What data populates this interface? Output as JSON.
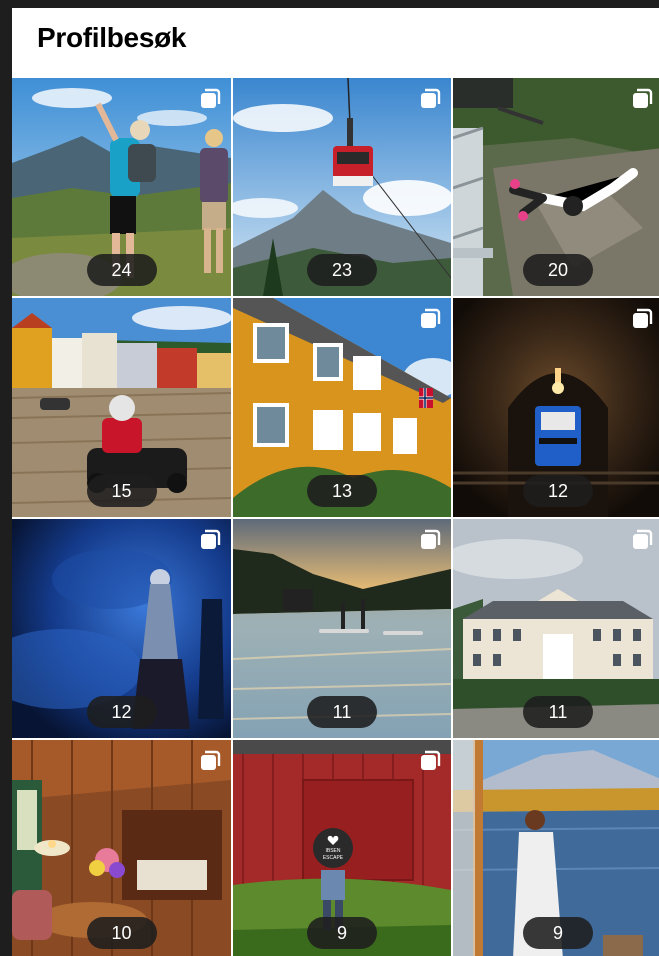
{
  "header": {
    "title": "Profilbesøk"
  },
  "tiles": [
    {
      "count": "24",
      "icon": "multi-image-icon"
    },
    {
      "count": "23",
      "icon": "multi-image-icon"
    },
    {
      "count": "20",
      "icon": "multi-image-icon"
    },
    {
      "count": "15",
      "icon": ""
    },
    {
      "count": "13",
      "icon": "multi-image-icon"
    },
    {
      "count": "12",
      "icon": "multi-image-icon"
    },
    {
      "count": "12",
      "icon": "multi-image-icon"
    },
    {
      "count": "11",
      "icon": "multi-image-icon"
    },
    {
      "count": "11",
      "icon": "multi-image-icon"
    },
    {
      "count": "10",
      "icon": "multi-image-icon"
    },
    {
      "count": "9",
      "icon": "multi-image-icon"
    },
    {
      "count": "9",
      "icon": ""
    }
  ],
  "sign": {
    "line1": "IBSEN",
    "line2": "ESCAPE"
  },
  "colors": {
    "page_bg": "#1e1e1e",
    "panel_bg": "#ffffff",
    "badge_bg": "#1e1e1e"
  }
}
